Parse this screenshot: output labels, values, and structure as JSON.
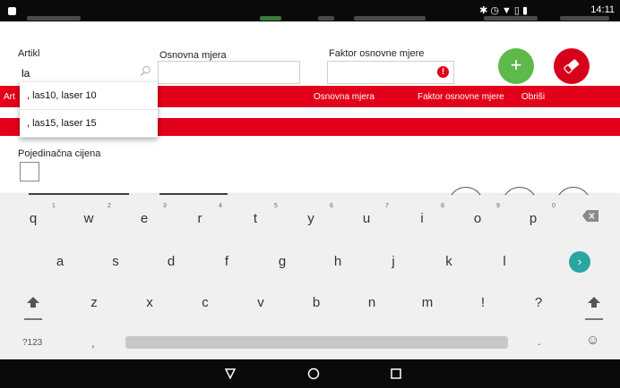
{
  "status_bar": {
    "clock": "14:11",
    "icons": [
      "bluetooth-icon",
      "alarm-icon",
      "wifi-icon",
      "sim-icon",
      "battery-icon"
    ]
  },
  "form": {
    "artikl_label": "Artikl",
    "artikl_value": "la",
    "osnovna_mjera_label": "Osnovna mjera",
    "faktor_label": "Faktor osnovne mjere",
    "pojedinacna_label": "Pojedinačna cijena"
  },
  "fab": {
    "add_label": "+"
  },
  "table_header": {
    "artikl_partial": "Art",
    "osnovna_mjera": "Osnovna mjera",
    "faktor": "Faktor osnovne mjere",
    "obrisi": "Obriši"
  },
  "suggestions": [
    ", las10, laser 10",
    ", las15, laser 15"
  ],
  "keyboard": {
    "row1": [
      {
        "key": "q",
        "hint": "1"
      },
      {
        "key": "w",
        "hint": "2"
      },
      {
        "key": "e",
        "hint": "3"
      },
      {
        "key": "r",
        "hint": "4"
      },
      {
        "key": "t",
        "hint": "5"
      },
      {
        "key": "y",
        "hint": "6"
      },
      {
        "key": "u",
        "hint": "7"
      },
      {
        "key": "i",
        "hint": "8"
      },
      {
        "key": "o",
        "hint": "9"
      },
      {
        "key": "p",
        "hint": "0"
      }
    ],
    "row2": [
      "a",
      "s",
      "d",
      "f",
      "g",
      "h",
      "j",
      "k",
      "l"
    ],
    "row3": [
      "z",
      "x",
      "c",
      "v",
      "b",
      "n",
      "m",
      "!",
      "?"
    ],
    "sym_label": "?123",
    "comma": ",",
    "period": ".",
    "emoji": "☺"
  },
  "colors": {
    "accent_red": "#e2001a",
    "add_green": "#5cb94a",
    "enter_teal": "#28a7a0"
  }
}
